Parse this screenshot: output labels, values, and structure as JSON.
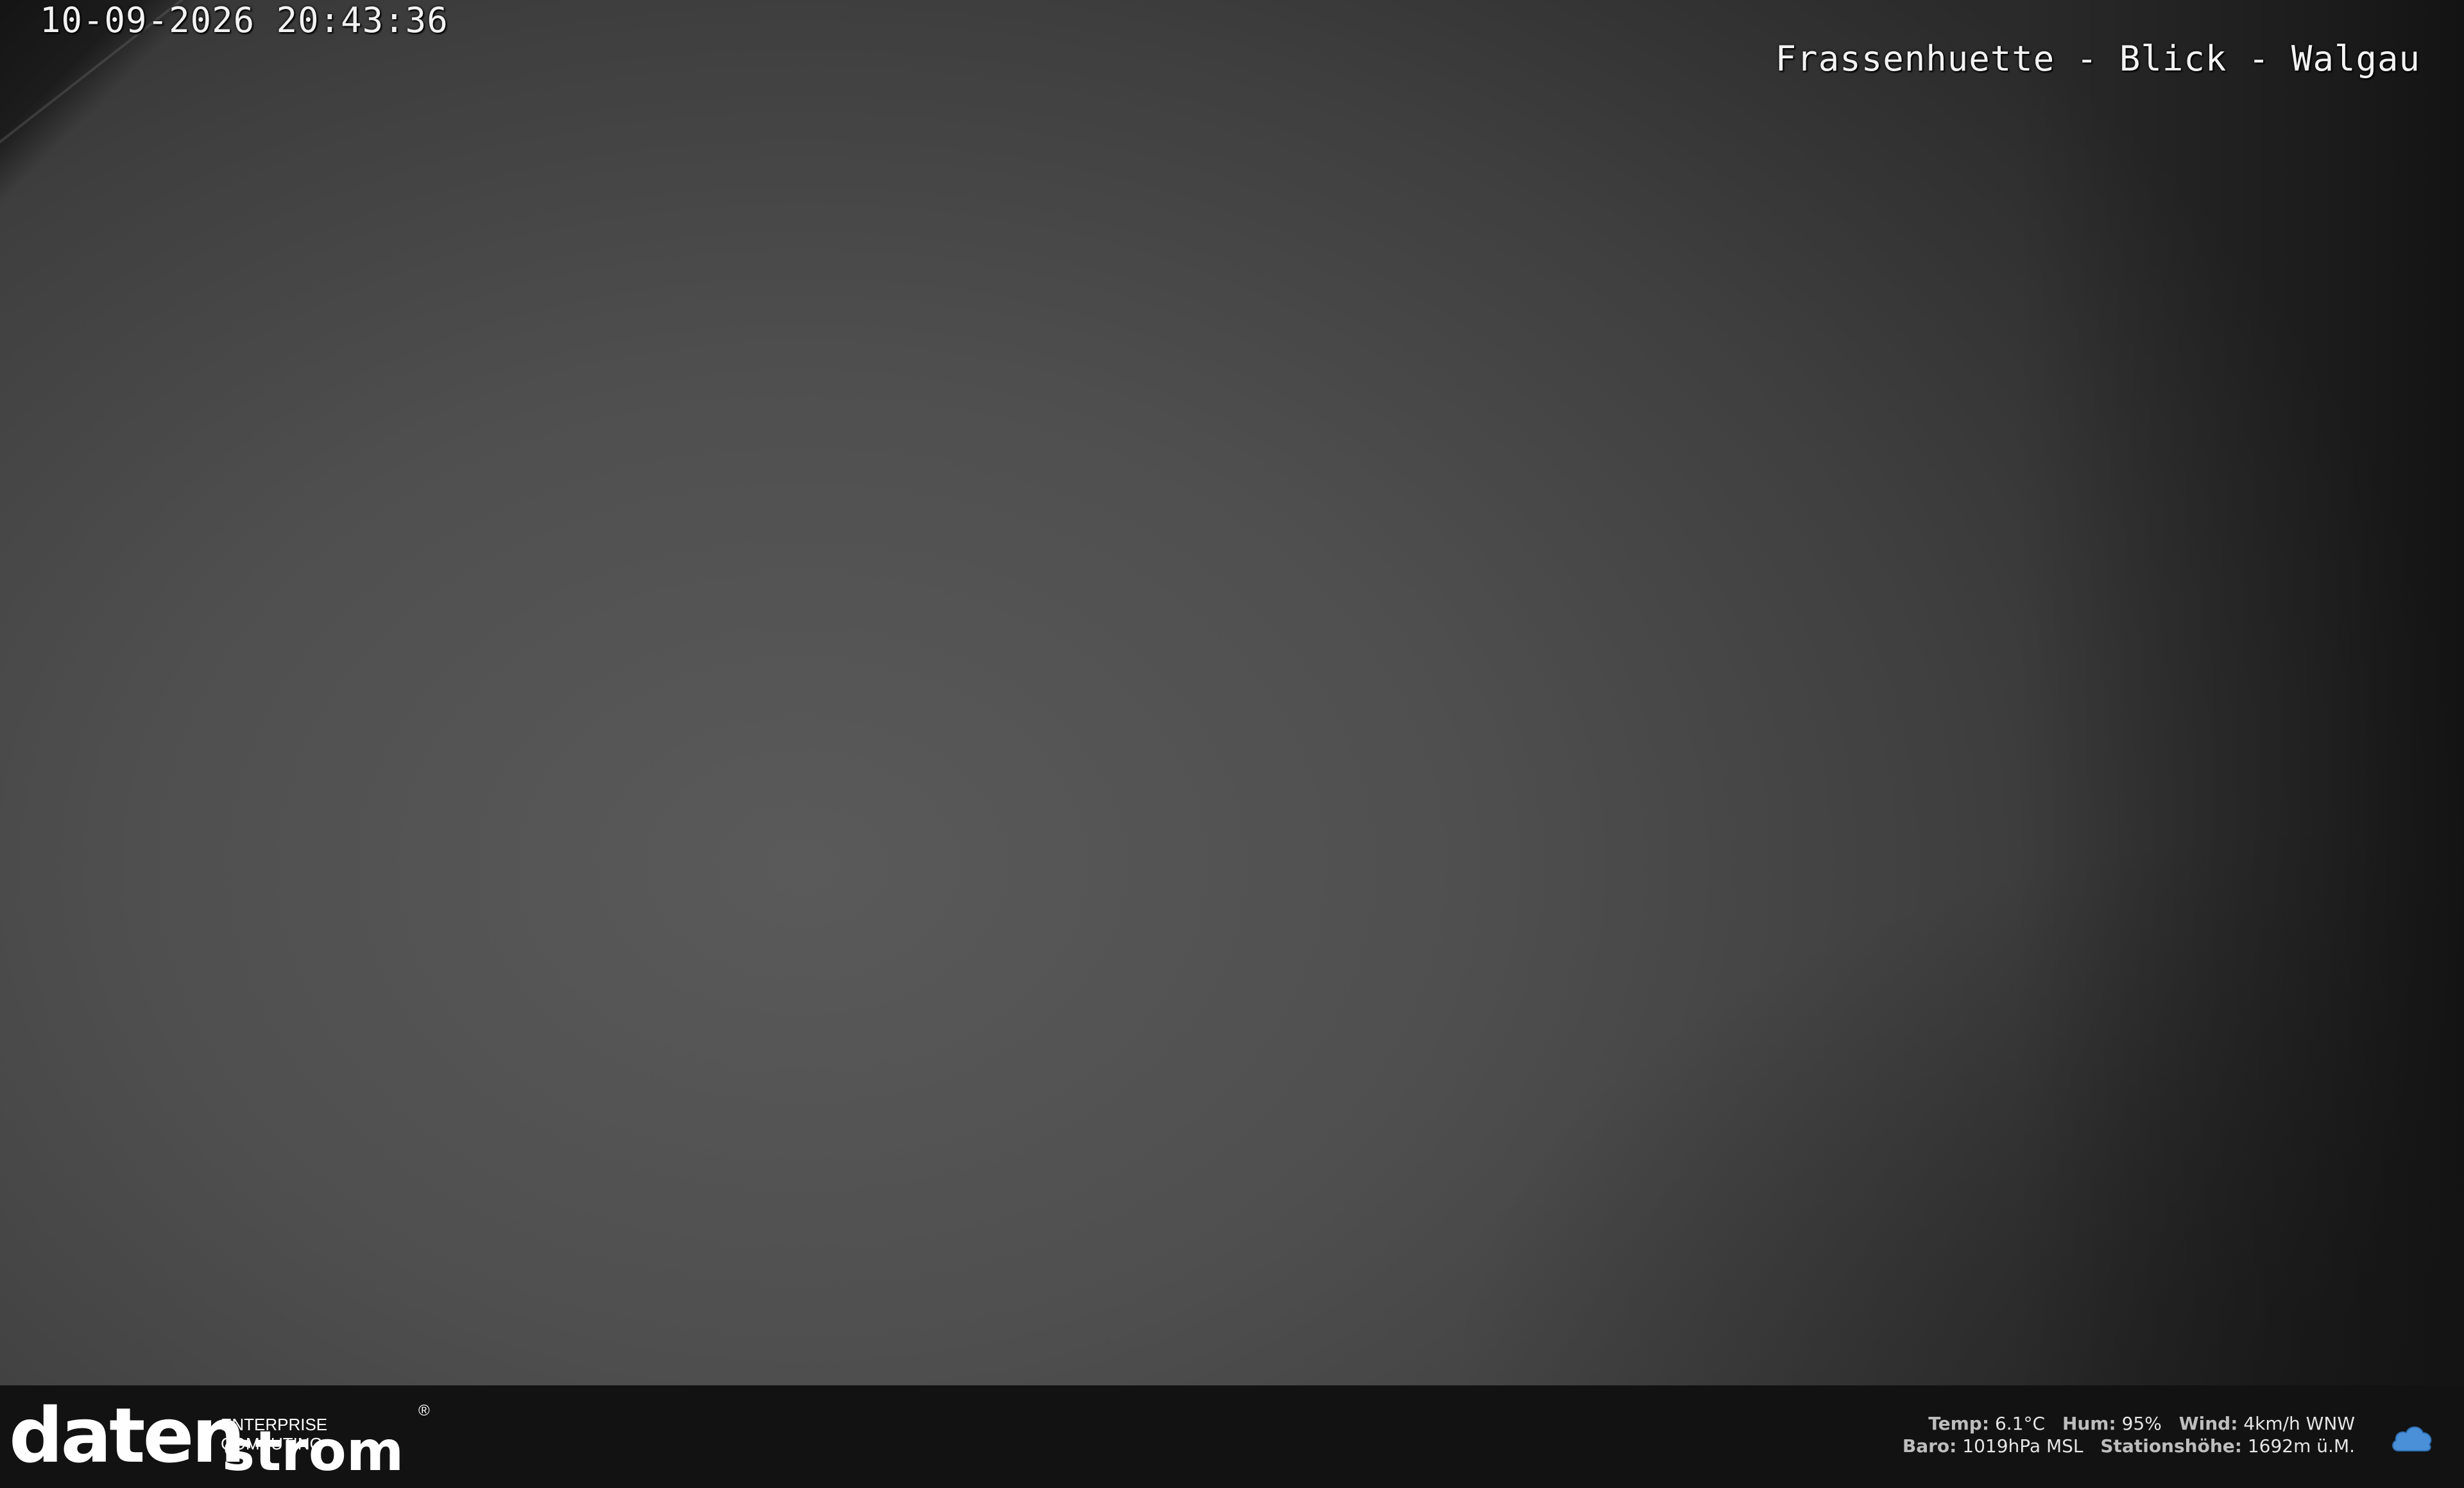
{
  "overlay": {
    "timestamp": "10-09-2026 20:43:36",
    "camera_title": "Frassenhuette - Blick - Walgau"
  },
  "footer": {
    "logo": {
      "word1": "daten",
      "tagline": "ENTERPRISE COMPUTING",
      "word2": "strom",
      "registered": "®"
    },
    "weather": {
      "temp_label": "Temp:",
      "temp_value": "6.1°C",
      "hum_label": "Hum:",
      "hum_value": "95%",
      "wind_label": "Wind:",
      "wind_value": "4km/h WNW",
      "baro_label": "Baro:",
      "baro_value": "1019hPa MSL",
      "altitude_label": "Stationshöhe:",
      "altitude_value": "1692m ü.M.",
      "icon": "cloud-icon",
      "icon_color": "#4a90d9"
    }
  },
  "colors": {
    "footer_bg": "#121212",
    "sky_gray": "#555555",
    "osd_text": "#f2f2f2"
  }
}
